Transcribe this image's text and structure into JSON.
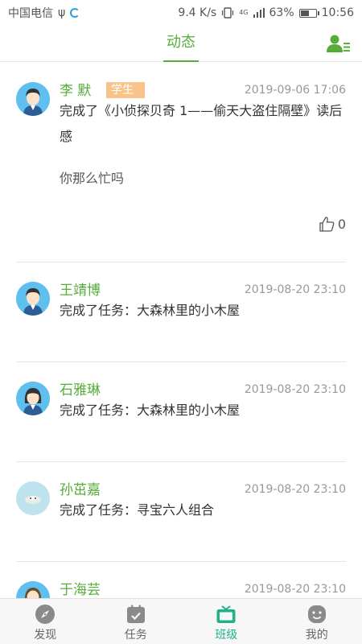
{
  "status_bar": {
    "carrier": "中国电信",
    "usb_symbol": "ψ",
    "speed": "9.4 K/s",
    "network": "4G",
    "battery": "63%",
    "battery_level": 0.63,
    "time": "10:56"
  },
  "header": {
    "title": "动态"
  },
  "posts": [
    {
      "author": "李 默",
      "role": "学生",
      "time": "2019-09-06 17:06",
      "content": "完成了《小侦探贝奇 1——偷天大盗住隔壁》读后感",
      "comment": "你那么忙吗",
      "likes": "0"
    },
    {
      "author": "王靖博",
      "time": "2019-08-20 23:10",
      "content": "完成了任务：大森林里的小木屋"
    },
    {
      "author": "石雅琳",
      "time": "2019-08-20 23:10",
      "content": "完成了任务：大森林里的小木屋"
    },
    {
      "author": "孙茁嘉",
      "time": "2019-08-20 23:10",
      "content": "完成了任务：寻宝六人组合"
    },
    {
      "author": "于海芸",
      "time": "2019-08-20 23:10"
    }
  ],
  "bottom_nav": [
    {
      "label": "发现",
      "icon": "compass-icon"
    },
    {
      "label": "任务",
      "icon": "task-calendar-icon"
    },
    {
      "label": "班级",
      "icon": "class-board-icon",
      "active": true
    },
    {
      "label": "我的",
      "icon": "profile-face-icon"
    }
  ],
  "colors": {
    "accent_green": "#56ad3a",
    "active_teal": "#1fb28a",
    "role_tag": "#f8c48c",
    "avatar_blue": "#5fc0ef"
  }
}
